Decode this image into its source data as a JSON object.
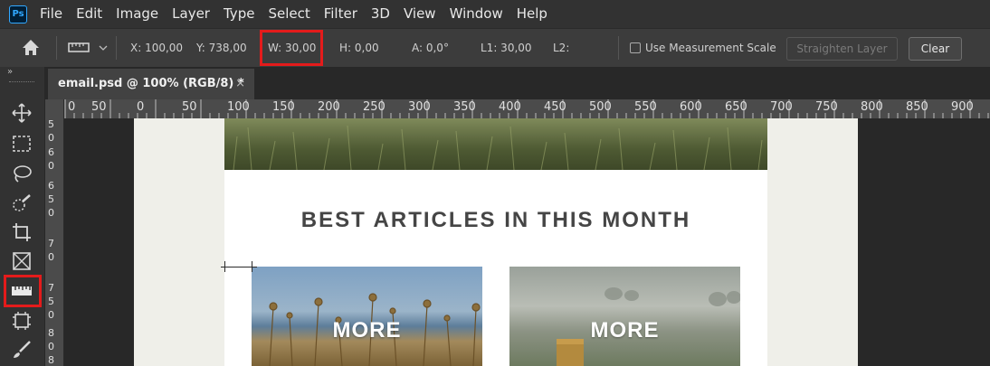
{
  "menu": [
    "File",
    "Edit",
    "Image",
    "Layer",
    "Type",
    "Select",
    "Filter",
    "3D",
    "View",
    "Window",
    "Help"
  ],
  "app_logo": "Ps",
  "options_bar": {
    "x": "X: 100,00",
    "y": "Y: 738,00",
    "w": "W: 30,00",
    "h": "H: 0,00",
    "a": "A: 0,0°",
    "l1": "L1: 30,00",
    "l2": "L2:",
    "use_measurement_scale": "Use Measurement Scale",
    "straighten_layer": "Straighten Layer",
    "clear": "Clear"
  },
  "document_tab": {
    "title": "email.psd @ 100% (RGB/8) *",
    "close": "×"
  },
  "hruler_labels": [
    "0",
    "50",
    "0",
    "50",
    "100",
    "150",
    "200",
    "250",
    "300",
    "350",
    "400",
    "450",
    "500",
    "550",
    "600",
    "650",
    "700",
    "750",
    "800",
    "850",
    "900"
  ],
  "vruler_labels": [
    "5",
    "0",
    "6",
    "0",
    "6",
    "5",
    "0",
    "7",
    "0",
    "7",
    "5",
    "0",
    "8",
    "0",
    "8"
  ],
  "canvas": {
    "heading": "BEST ARTICLES IN THIS MONTH",
    "card1_label": "MORE",
    "card2_label": "MORE"
  },
  "colors": {
    "highlight": "#e41b1b",
    "menubar": "#323232",
    "artboard": "#efefe9"
  }
}
